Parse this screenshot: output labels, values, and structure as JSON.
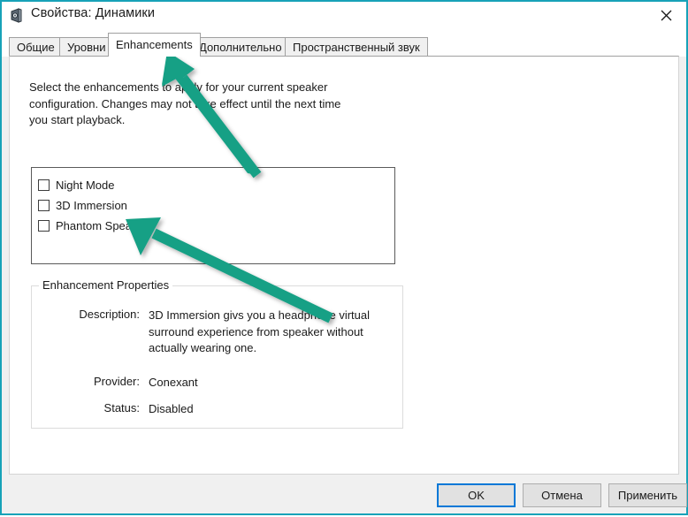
{
  "window": {
    "title": "Свойства: Динамики",
    "icon": "speaker-icon",
    "close_label": "✕",
    "accent_color": "#17a2b8"
  },
  "tabs": [
    {
      "label": "Общие",
      "active": false
    },
    {
      "label": "Уровни",
      "active": false
    },
    {
      "label": "Enhancements",
      "active": true
    },
    {
      "label": "Дополнительно",
      "active": false
    },
    {
      "label": "Пространственный звук",
      "active": false
    }
  ],
  "content": {
    "intro": "Select the enhancements to apply for your current speaker configuration. Changes may not take effect until the next time you start playback.",
    "enhancements": [
      {
        "label": "Night Mode",
        "checked": false
      },
      {
        "label": "3D Immersion",
        "checked": false
      },
      {
        "label": "Phantom Speaker",
        "checked": false
      }
    ],
    "properties": {
      "legend": "Enhancement Properties",
      "description_label": "Description:",
      "description_value": "3D Immersion givs you a headphone virtual surround experience from speaker without actually wearing one.",
      "provider_label": "Provider:",
      "provider_value": "Conexant",
      "status_label": "Status:",
      "status_value": "Disabled"
    }
  },
  "footer": {
    "ok_label": "OK",
    "cancel_label": "Отмена",
    "apply_label": "Применить"
  },
  "annotations": {
    "arrow_color": "#19a085",
    "arrow_1_target": "Enhancements",
    "arrow_2_target": "Phantom Speaker"
  }
}
